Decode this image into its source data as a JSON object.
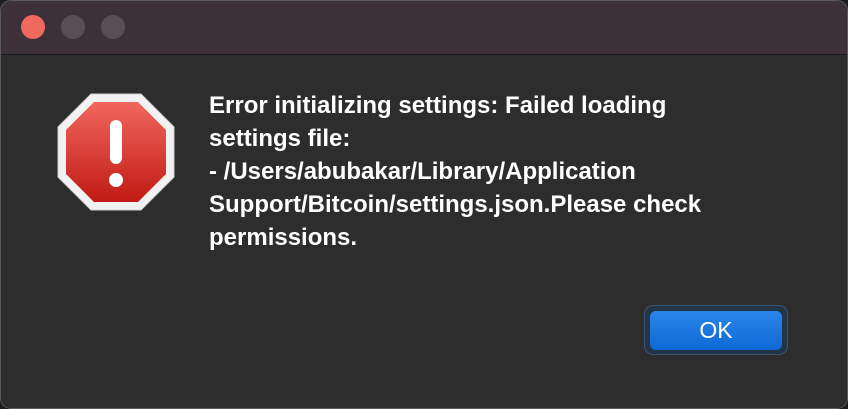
{
  "window": {
    "title": ""
  },
  "titlebar": {
    "buttons": [
      {
        "name": "close",
        "color": "#ee6a5f"
      },
      {
        "name": "minimize",
        "color": "#5a4d56"
      },
      {
        "name": "zoom",
        "color": "#5a4d56"
      }
    ]
  },
  "dialog": {
    "icon": "stop-sign-warning-icon",
    "icon_color": "#d42b22",
    "message": "Error initializing settings: Failed loading\nsettings file:\n- /Users/abubakar/Library/Application\nSupport/Bitcoin/settings.json.Please check\npermissions.",
    "ok_label": "OK",
    "accent": "#1a78e0"
  }
}
